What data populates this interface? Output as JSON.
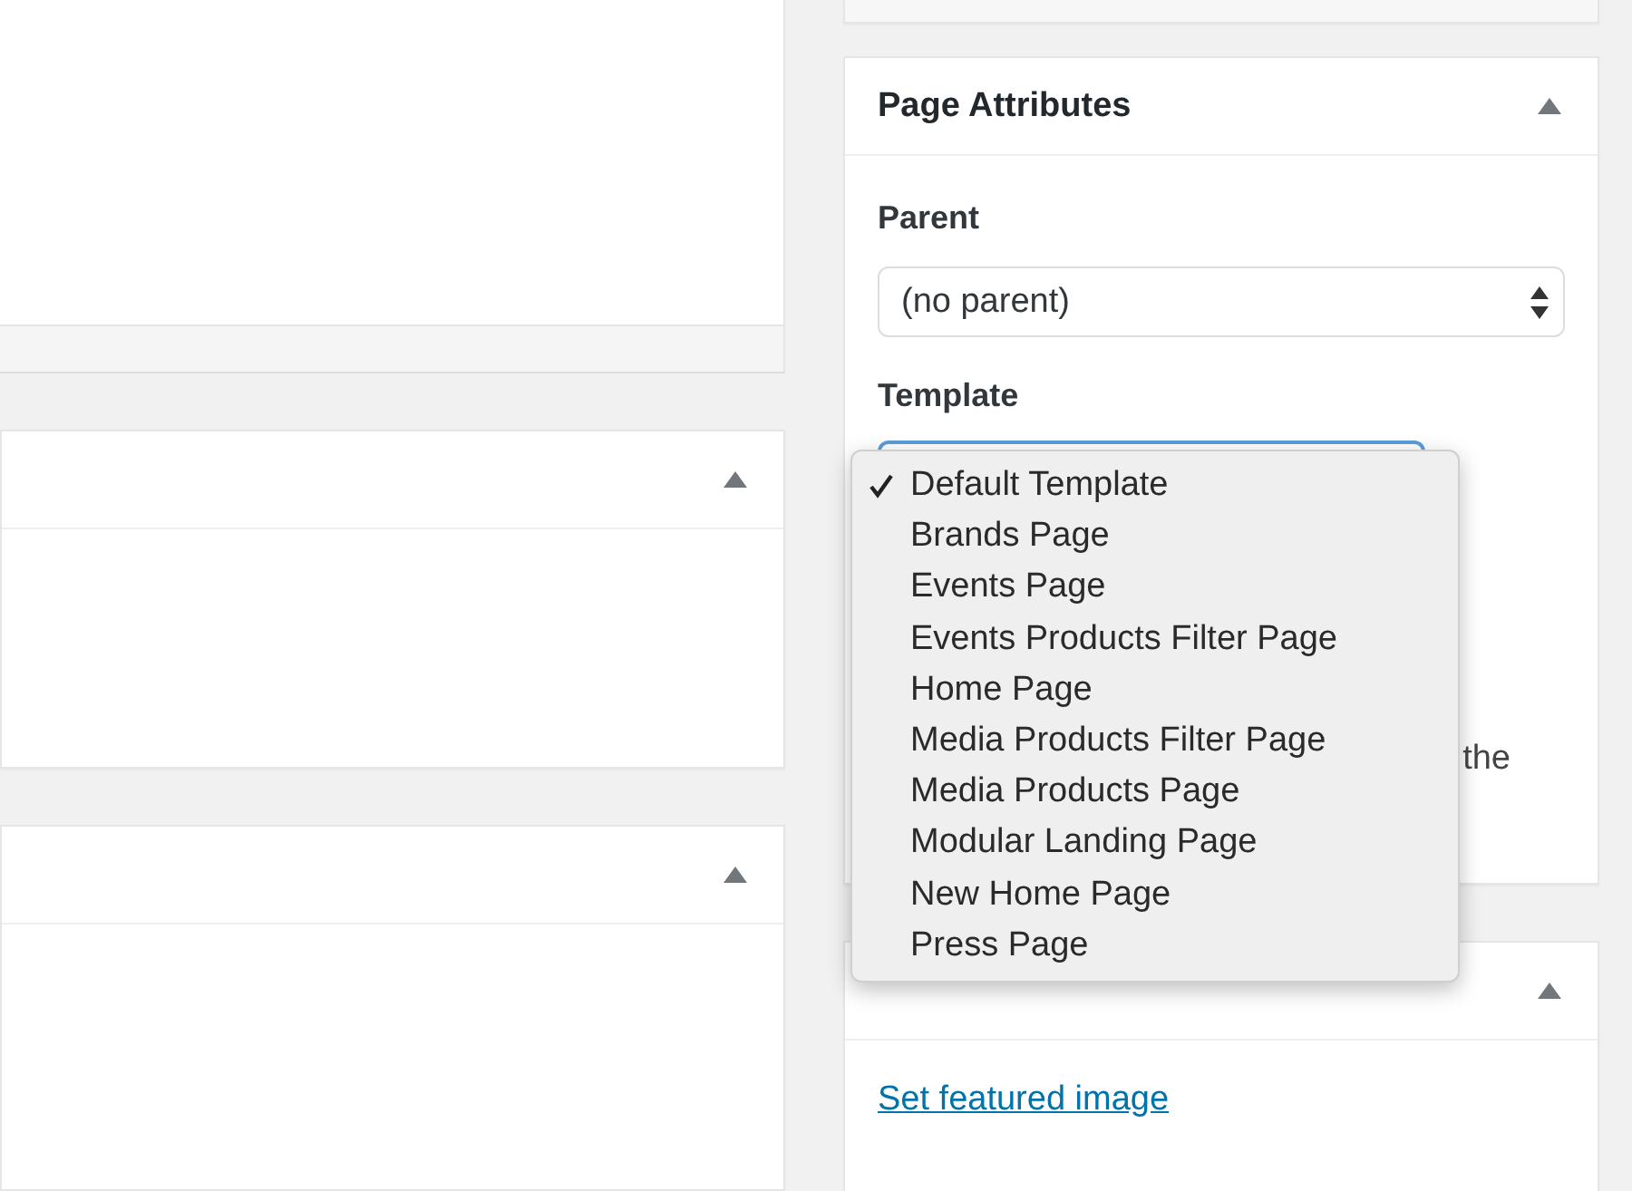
{
  "page_attributes": {
    "title": "Page Attributes",
    "parent_label": "Parent",
    "parent_value": "(no parent)",
    "template_label": "Template",
    "description": "the"
  },
  "template_menu": [
    {
      "label": "Default Template",
      "selected": true
    },
    {
      "label": "Brands Page",
      "selected": false
    },
    {
      "label": "Events Page",
      "selected": false
    },
    {
      "label": "Events Products Filter Page",
      "selected": false
    },
    {
      "label": "Home Page",
      "selected": false
    },
    {
      "label": "Media Products Filter Page",
      "selected": false
    },
    {
      "label": "Media Products Page",
      "selected": false
    },
    {
      "label": "Modular Landing Page",
      "selected": false
    },
    {
      "label": "New Home Page",
      "selected": false
    },
    {
      "label": "Press Page",
      "selected": false
    }
  ],
  "featured_image": {
    "link": "Set featured image"
  }
}
